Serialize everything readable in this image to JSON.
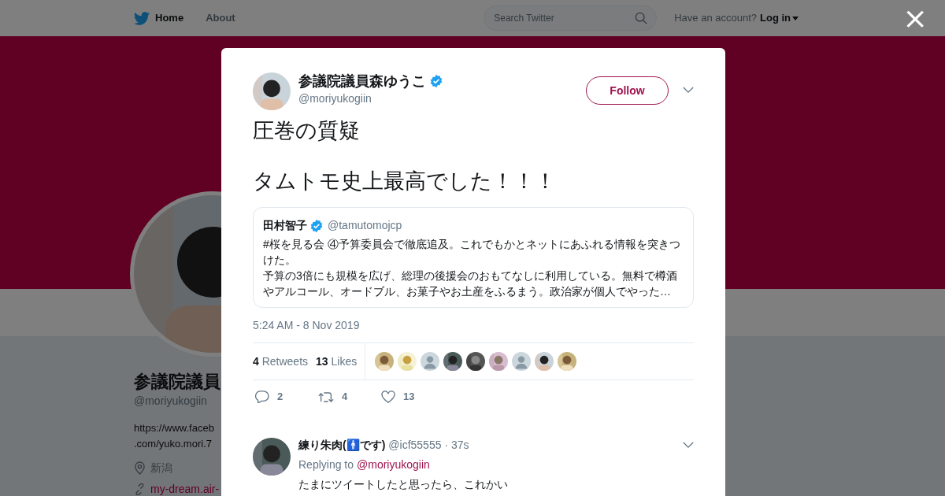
{
  "topbar": {
    "nav": [
      {
        "label": "Home",
        "selected": true
      },
      {
        "label": "About",
        "selected": false
      }
    ],
    "search": {
      "placeholder": "Search Twitter"
    },
    "account_prompt": "Have an account?",
    "login": "Log in"
  },
  "profile": {
    "name": "参議院議員",
    "handle": "@moriyukogiin",
    "bio": [
      "https://www.faceb",
      ".com/yuko.mori.7"
    ],
    "location": "新潟",
    "link": "my-dream.air-"
  },
  "close": "×",
  "tweet": {
    "name": "参議院議員森ゆうこ",
    "verified": true,
    "handle": "@moriyukogiin",
    "follow": "Follow",
    "text": [
      "圧巻の質疑",
      "タムトモ史上最高でした！！！"
    ],
    "quote": {
      "name": "田村智子",
      "verified": true,
      "handle": "@tamutomojcp",
      "text": [
        "#桜を見る会 ④予算委員会で徹底追及。これでもかとネットにあふれる情報を突きつけた。",
        "予算の3倍にも規模を広げ、総理の後援会のおもてなしに利用している。無料で樽酒やアルコール、オードブル、お菓子やお土産をふるまう。政治家が個人でやった…"
      ]
    },
    "time": "5:24 AM - 8 Nov 2019",
    "stats": [
      {
        "count": "4",
        "label": "Retweets"
      },
      {
        "count": "13",
        "label": "Likes"
      }
    ],
    "likers": [
      {
        "kind": "picture"
      },
      {
        "kind": "picture"
      },
      {
        "kind": "default"
      },
      {
        "kind": "picture"
      },
      {
        "kind": "picture"
      },
      {
        "kind": "picture"
      },
      {
        "kind": "default"
      },
      {
        "kind": "picture"
      },
      {
        "kind": "picture"
      }
    ],
    "actions": [
      {
        "kind": "reply",
        "count": "2"
      },
      {
        "kind": "retweet",
        "count": "4"
      },
      {
        "kind": "like",
        "count": "13"
      }
    ]
  },
  "reply": {
    "name": "練り朱肉(🚹です)",
    "handle": "@icf55555",
    "time": "· 37s",
    "replying_to": "Replying to",
    "mention": "@moriyukogiin",
    "text": "たまにツイートしたと思ったら、これかい"
  }
}
